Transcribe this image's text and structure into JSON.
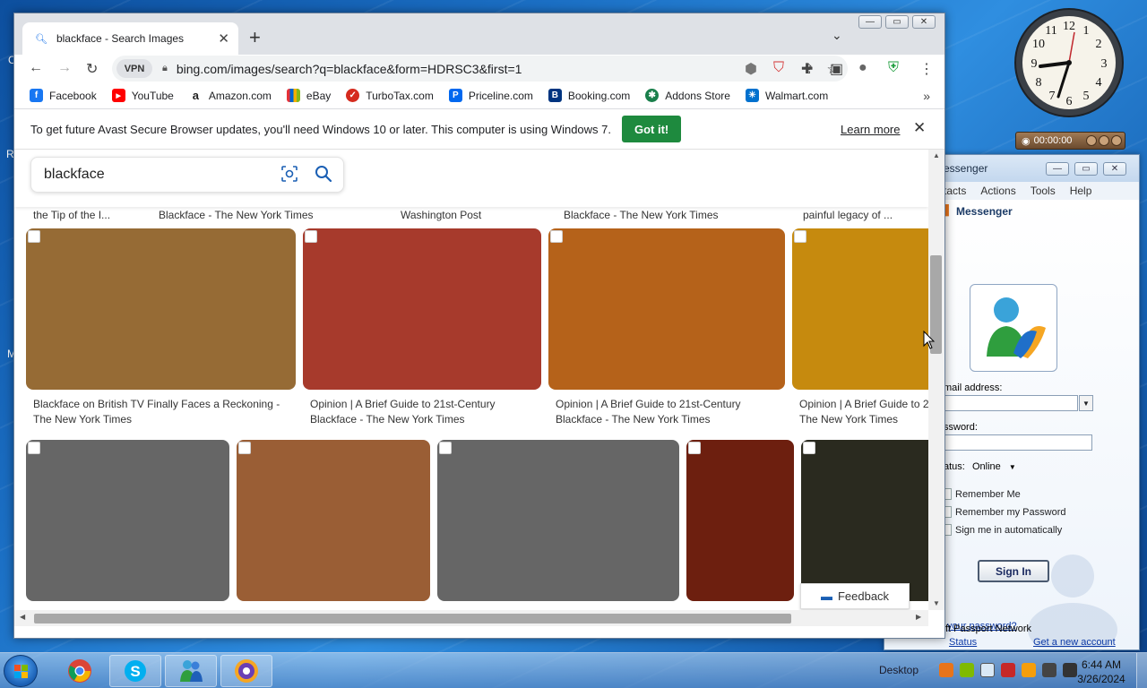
{
  "desktop": {
    "taskbar_desktop_label": "Desktop",
    "clock_time": "6:44 AM",
    "clock_date": "3/26/2024",
    "timer_gadget": "00:00:00",
    "desk_bits": [
      "R",
      "C",
      "M"
    ]
  },
  "browser": {
    "tab_title": "blackface - Search Images",
    "vpn_label": "VPN",
    "url": "bing.com/images/search?q=blackface&form=HDRSC3&first=1",
    "bookmarks": [
      {
        "label": "Facebook",
        "icon": "facebook-icon",
        "color": "#1877f2",
        "glyph": "f"
      },
      {
        "label": "YouTube",
        "icon": "youtube-icon",
        "color": "#ff0000",
        "glyph": "▶"
      },
      {
        "label": "Amazon.com",
        "icon": "amazon-icon",
        "color": "#222222",
        "glyph": "a"
      },
      {
        "label": "eBay",
        "icon": "ebay-icon",
        "color": "#e53238",
        "glyph": "e"
      },
      {
        "label": "TurboTax.com",
        "icon": "turbotax-icon",
        "color": "#d52b1e",
        "glyph": "✓"
      },
      {
        "label": "Priceline.com",
        "icon": "priceline-icon",
        "color": "#0068ef",
        "glyph": "P"
      },
      {
        "label": "Booking.com",
        "icon": "booking-icon",
        "color": "#003580",
        "glyph": "B"
      },
      {
        "label": "Addons Store",
        "icon": "addons-icon",
        "color": "#1a7f4b",
        "glyph": "✱"
      },
      {
        "label": "Walmart.com",
        "icon": "walmart-icon",
        "color": "#0071ce",
        "glyph": "✳"
      }
    ],
    "infobar": {
      "message": "To get future Avast Secure Browser updates, you'll need Windows 10 or later. This computer is using Windows 7.",
      "button": "Got it!",
      "link": "Learn more"
    },
    "search_query": "blackface",
    "top_captions": [
      "the Tip of the I...",
      "Blackface - The New York Times",
      "Washington Post",
      "Blackface - The New York Times",
      "painful legacy of ..."
    ],
    "row1_captions": [
      "Blackface on British TV Finally Faces a Reckoning - The New York Times",
      "Opinion | A Brief Guide to 21st-Century Blackface - The New York Times",
      "Opinion | A Brief Guide to 21st-Century Blackface - The New York Times",
      "Opinion | A Brief Guide to 2 The New York Times"
    ],
    "row1_colors": [
      "#966b35",
      "#a73a2c",
      "#b5621a",
      "#c68a0e"
    ],
    "row2_colors": [
      "#666666",
      "#9a5e35",
      "#666666",
      "#6d1f0f",
      "#2a2a1f"
    ],
    "feedback": "Feedback"
  },
  "messenger": {
    "title": "essenger",
    "menu": [
      "tacts",
      "Actions",
      "Tools",
      "Help"
    ],
    "brand": "Messenger",
    "email_label": "mail address:",
    "password_label": "ssword:",
    "status_label": "atus:",
    "status_value": "Online",
    "checks": [
      "Remember Me",
      "Remember my Password",
      "Sign me in automatically"
    ],
    "sign_in": "Sign In",
    "forgot": "your password?",
    "status_link": "Status",
    "new_account": "Get a new account",
    "passport": "ft Passport Network"
  },
  "colors": {
    "got_it": "#1e8a3e",
    "taskbar": "#5a8cc8"
  }
}
